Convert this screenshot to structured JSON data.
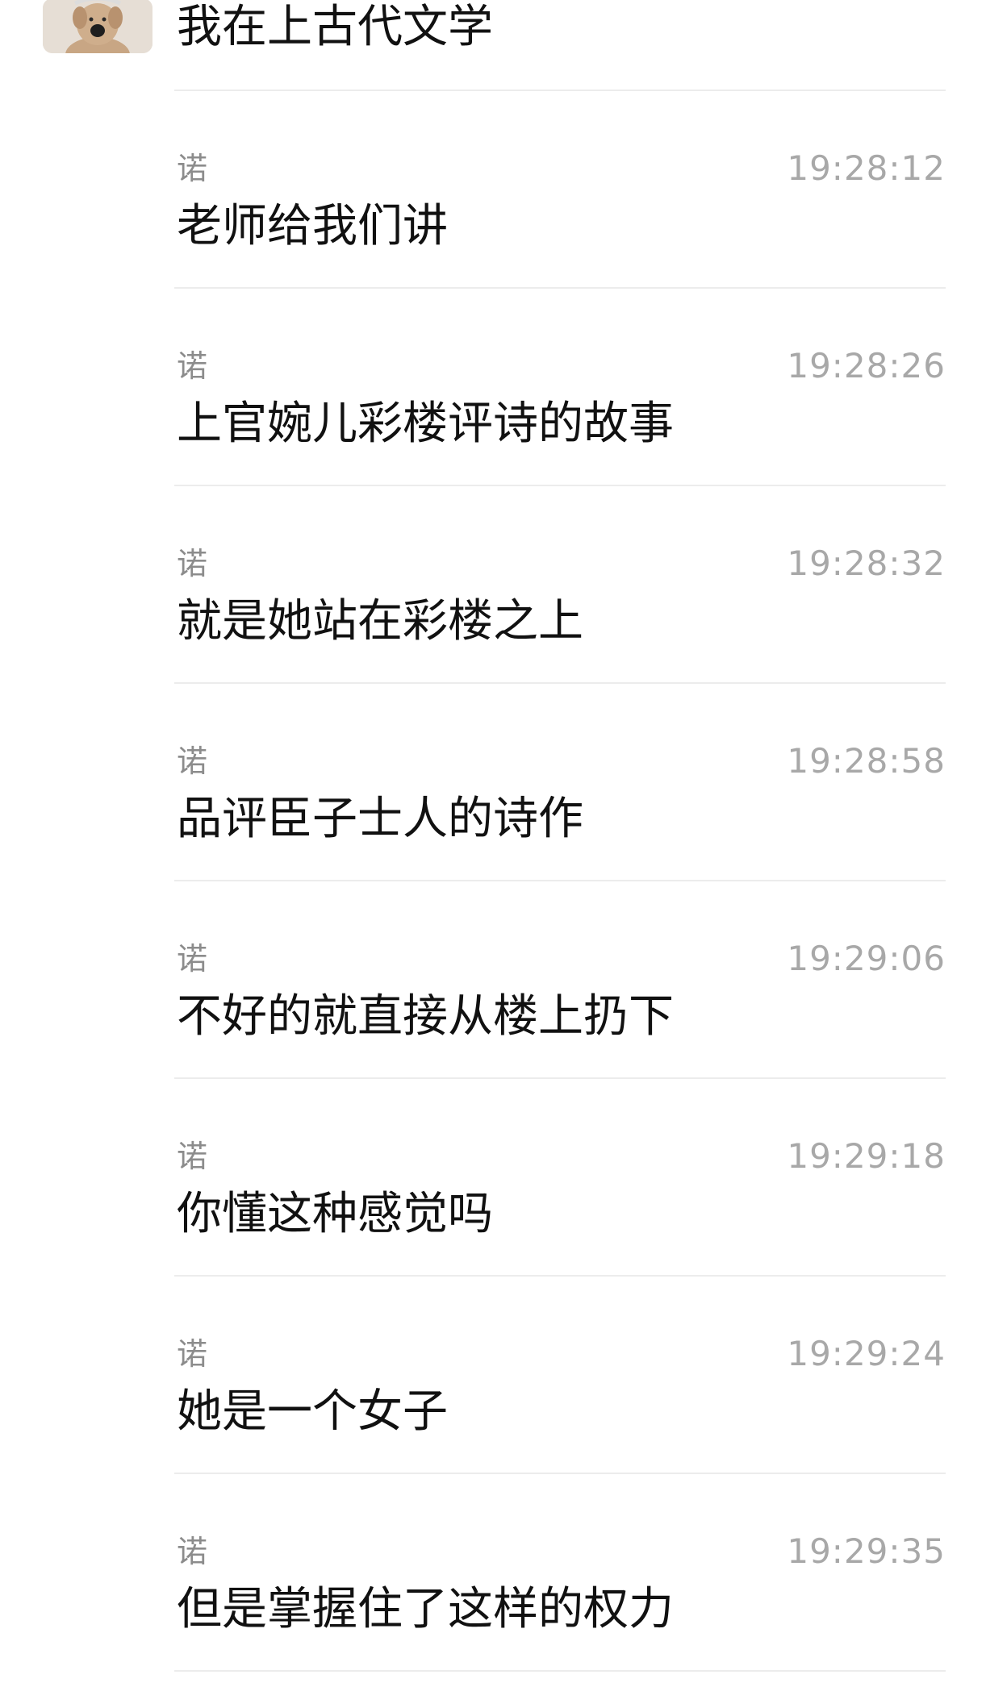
{
  "first_message": {
    "avatar_icon": "dog-avatar-icon",
    "text": "我在上古代文学"
  },
  "messages": [
    {
      "sender": "诺",
      "time": "19:28:12",
      "text": "老师给我们讲"
    },
    {
      "sender": "诺",
      "time": "19:28:26",
      "text": "上官婉儿彩楼评诗的故事"
    },
    {
      "sender": "诺",
      "time": "19:28:32",
      "text": "就是她站在彩楼之上"
    },
    {
      "sender": "诺",
      "time": "19:28:58",
      "text": "品评臣子士人的诗作"
    },
    {
      "sender": "诺",
      "time": "19:29:06",
      "text": "不好的就直接从楼上扔下"
    },
    {
      "sender": "诺",
      "time": "19:29:18",
      "text": "你懂这种感觉吗"
    },
    {
      "sender": "诺",
      "time": "19:29:24",
      "text": "她是一个女子"
    },
    {
      "sender": "诺",
      "time": "19:29:35",
      "text": "但是掌握住了这样的权力"
    }
  ]
}
